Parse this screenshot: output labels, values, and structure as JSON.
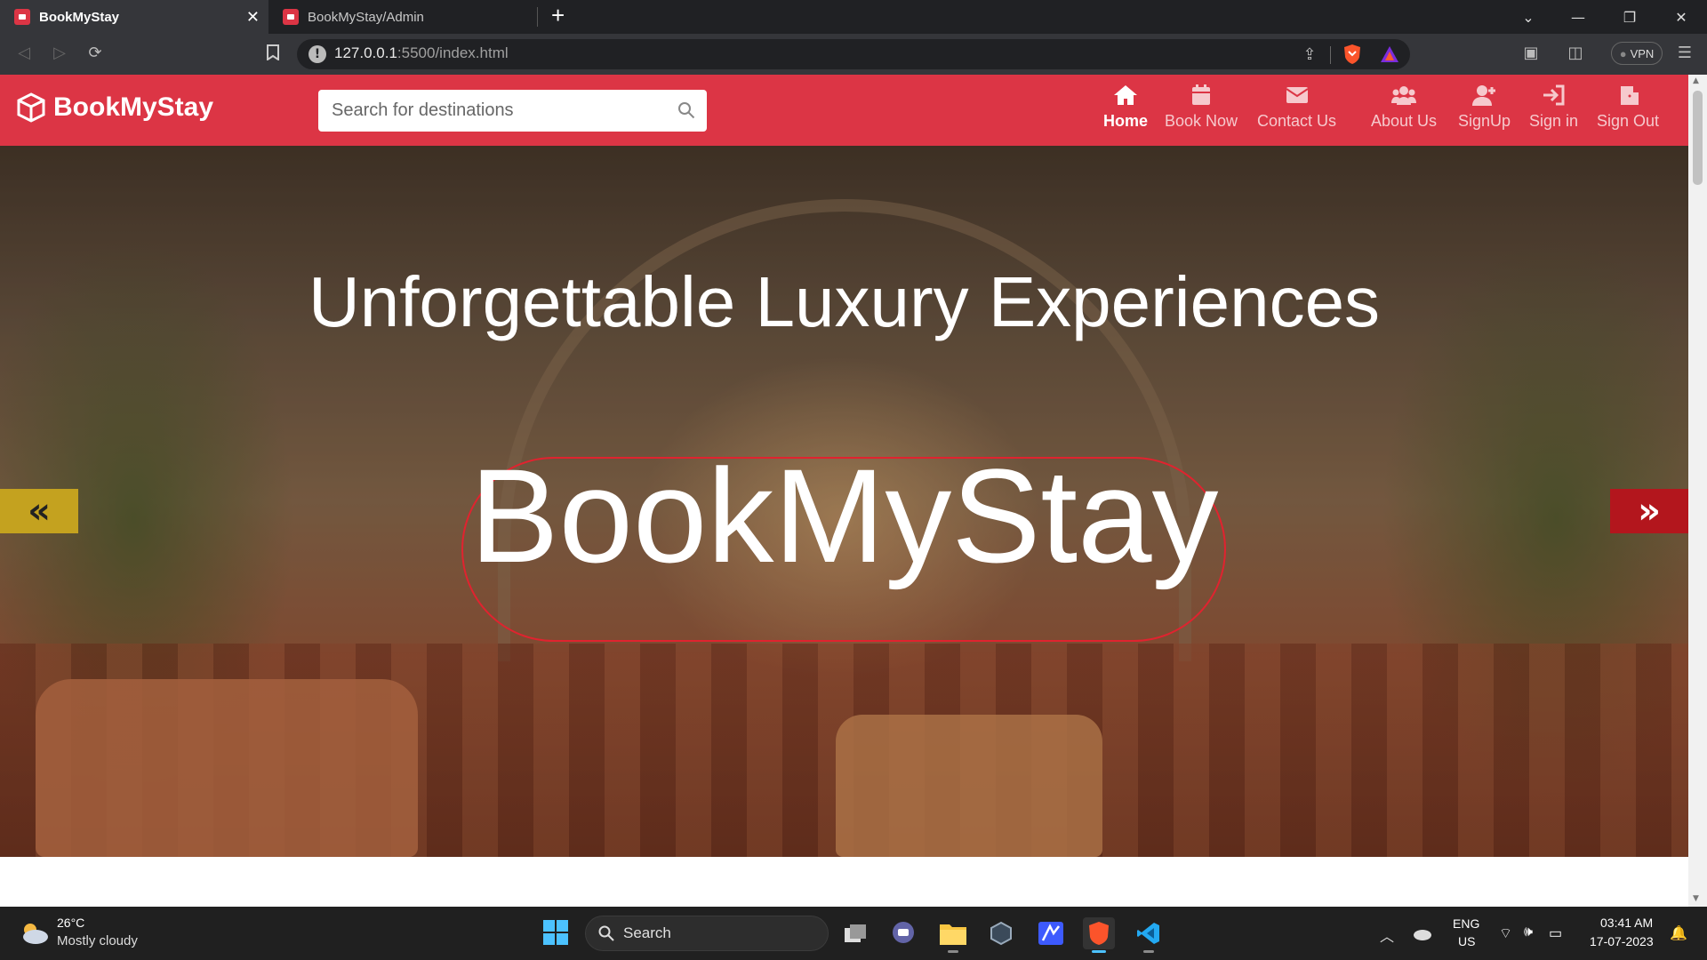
{
  "browser": {
    "tabs": [
      {
        "title": "BookMyStay",
        "active": true
      },
      {
        "title": "BookMyStay/Admin",
        "active": false
      }
    ],
    "new_tab": "+",
    "close_tab": "✕",
    "url_host": "127.0.0.1",
    "url_path": ":5500/index.html",
    "vpn_label": "VPN"
  },
  "site": {
    "brand": "BookMyStay",
    "search_placeholder": "Search for destinations",
    "nav": [
      {
        "label": "Home",
        "icon": "home-icon",
        "active": true
      },
      {
        "label": "Book Now",
        "icon": "calendar-icon",
        "active": false
      },
      {
        "label": "Contact Us",
        "icon": "envelope-icon",
        "active": false
      },
      {
        "label": "About Us",
        "icon": "users-icon",
        "active": false
      },
      {
        "label": "SignUp",
        "icon": "user-plus-icon",
        "active": false
      },
      {
        "label": "Sign in",
        "icon": "sign-in-icon",
        "active": false
      },
      {
        "label": "Sign Out",
        "icon": "door-icon",
        "active": false
      }
    ],
    "hero": {
      "title": "Unforgettable Luxury Experiences",
      "brand_text": "BookMyStay",
      "prev": "«",
      "next": "»"
    },
    "colors": {
      "primary": "#dc3545",
      "prev_button": "#c4a21f",
      "next_button": "#b3161d"
    }
  },
  "taskbar": {
    "weather_temp": "26°C",
    "weather_desc": "Mostly cloudy",
    "search_label": "Search",
    "lang_top": "ENG",
    "lang_bottom": "US",
    "time": "03:41 AM",
    "date": "17-07-2023"
  }
}
